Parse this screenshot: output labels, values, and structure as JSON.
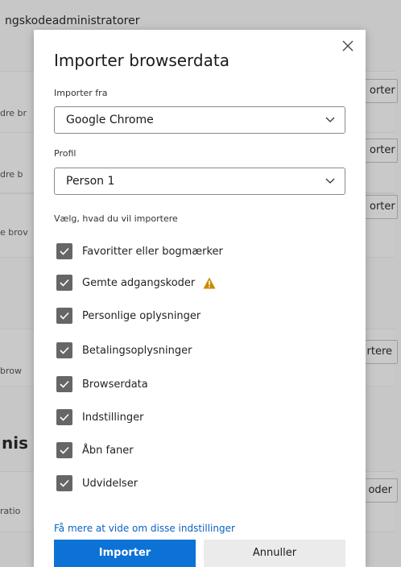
{
  "background": {
    "header_text": "ngskodeadministratorer",
    "side_texts": [
      "dre br",
      "dre b",
      "e brov",
      "brow",
      "ratio"
    ],
    "buttons": [
      "orter",
      "orter",
      "orter",
      "rtere",
      "oder"
    ],
    "section_heading": "nis"
  },
  "dialog": {
    "title": "Importer browserdata",
    "import_from_label": "Importer fra",
    "import_from_value": "Google Chrome",
    "profile_label": "Profil",
    "profile_value": "Person 1",
    "choose_label": "Vælg, hvad du vil importere",
    "items": [
      {
        "label": "Favoritter eller bogmærker",
        "checked": true,
        "warning": false
      },
      {
        "label": "Gemte adgangskoder",
        "checked": true,
        "warning": true
      },
      {
        "label": "Personlige oplysninger",
        "checked": true,
        "warning": false
      },
      {
        "label": "Betalingsoplysninger",
        "checked": true,
        "warning": false
      },
      {
        "label": "Browserdata",
        "checked": true,
        "warning": false
      },
      {
        "label": "Indstillinger",
        "checked": true,
        "warning": false
      },
      {
        "label": "Åbn faner",
        "checked": true,
        "warning": false
      },
      {
        "label": "Udvidelser",
        "checked": true,
        "warning": false
      }
    ],
    "learn_more_link": "Få mere at vide om disse indstillinger",
    "import_button": "Importer",
    "cancel_button": "Annuller"
  },
  "colors": {
    "primary": "#0c72d6",
    "link": "#0b62c4",
    "checkbox": "#666666",
    "warning": "#c98a00"
  }
}
